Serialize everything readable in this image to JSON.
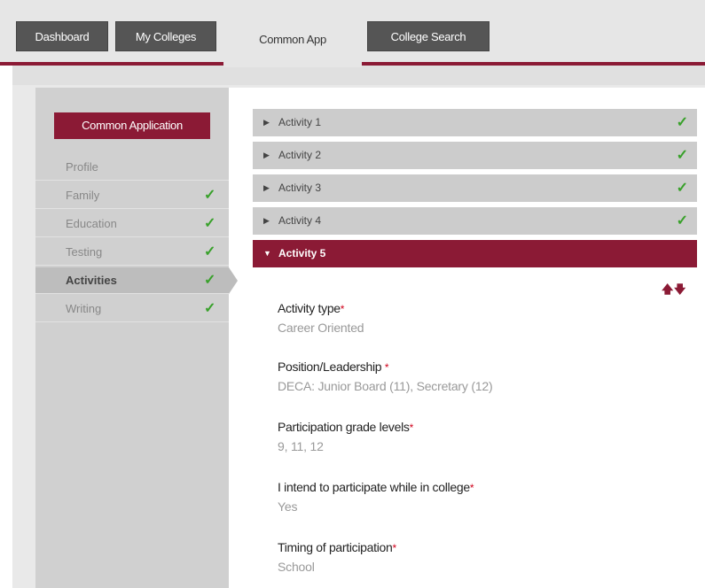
{
  "tabs": [
    {
      "label": "Dashboard"
    },
    {
      "label": "My Colleges"
    },
    {
      "label": "Common App"
    },
    {
      "label": "College Search"
    }
  ],
  "sidebar": {
    "title": "Common Application",
    "items": [
      {
        "label": "Profile",
        "complete": false
      },
      {
        "label": "Family",
        "complete": true
      },
      {
        "label": "Education",
        "complete": true
      },
      {
        "label": "Testing",
        "complete": true
      },
      {
        "label": "Activities",
        "complete": true,
        "active": true
      },
      {
        "label": "Writing",
        "complete": true
      }
    ]
  },
  "activities": [
    {
      "label": "Activity 1",
      "complete": true,
      "expanded": false
    },
    {
      "label": "Activity 2",
      "complete": true,
      "expanded": false
    },
    {
      "label": "Activity 3",
      "complete": true,
      "expanded": false
    },
    {
      "label": "Activity 4",
      "complete": true,
      "expanded": false
    },
    {
      "label": "Activity 5",
      "complete": false,
      "expanded": true
    }
  ],
  "activity5": {
    "fields": [
      {
        "label": "Activity type",
        "value": "Career Oriented"
      },
      {
        "label": "Position/Leadership ",
        "value": "DECA: Junior Board (11), Secretary (12)"
      },
      {
        "label": "Participation grade levels",
        "value": "9, 11, 12"
      },
      {
        "label": "I intend to participate while in college",
        "value": "Yes"
      },
      {
        "label": "Timing of participation",
        "value": "School"
      }
    ]
  },
  "glyphs": {
    "required": "*",
    "check": "✓",
    "collapsed": "▶",
    "expanded": "▼",
    "move_up": "🡅",
    "move_down": "🡇"
  },
  "colors": {
    "brand": "#8b1a35",
    "check": "#39a12b",
    "required": "#d0021b"
  }
}
